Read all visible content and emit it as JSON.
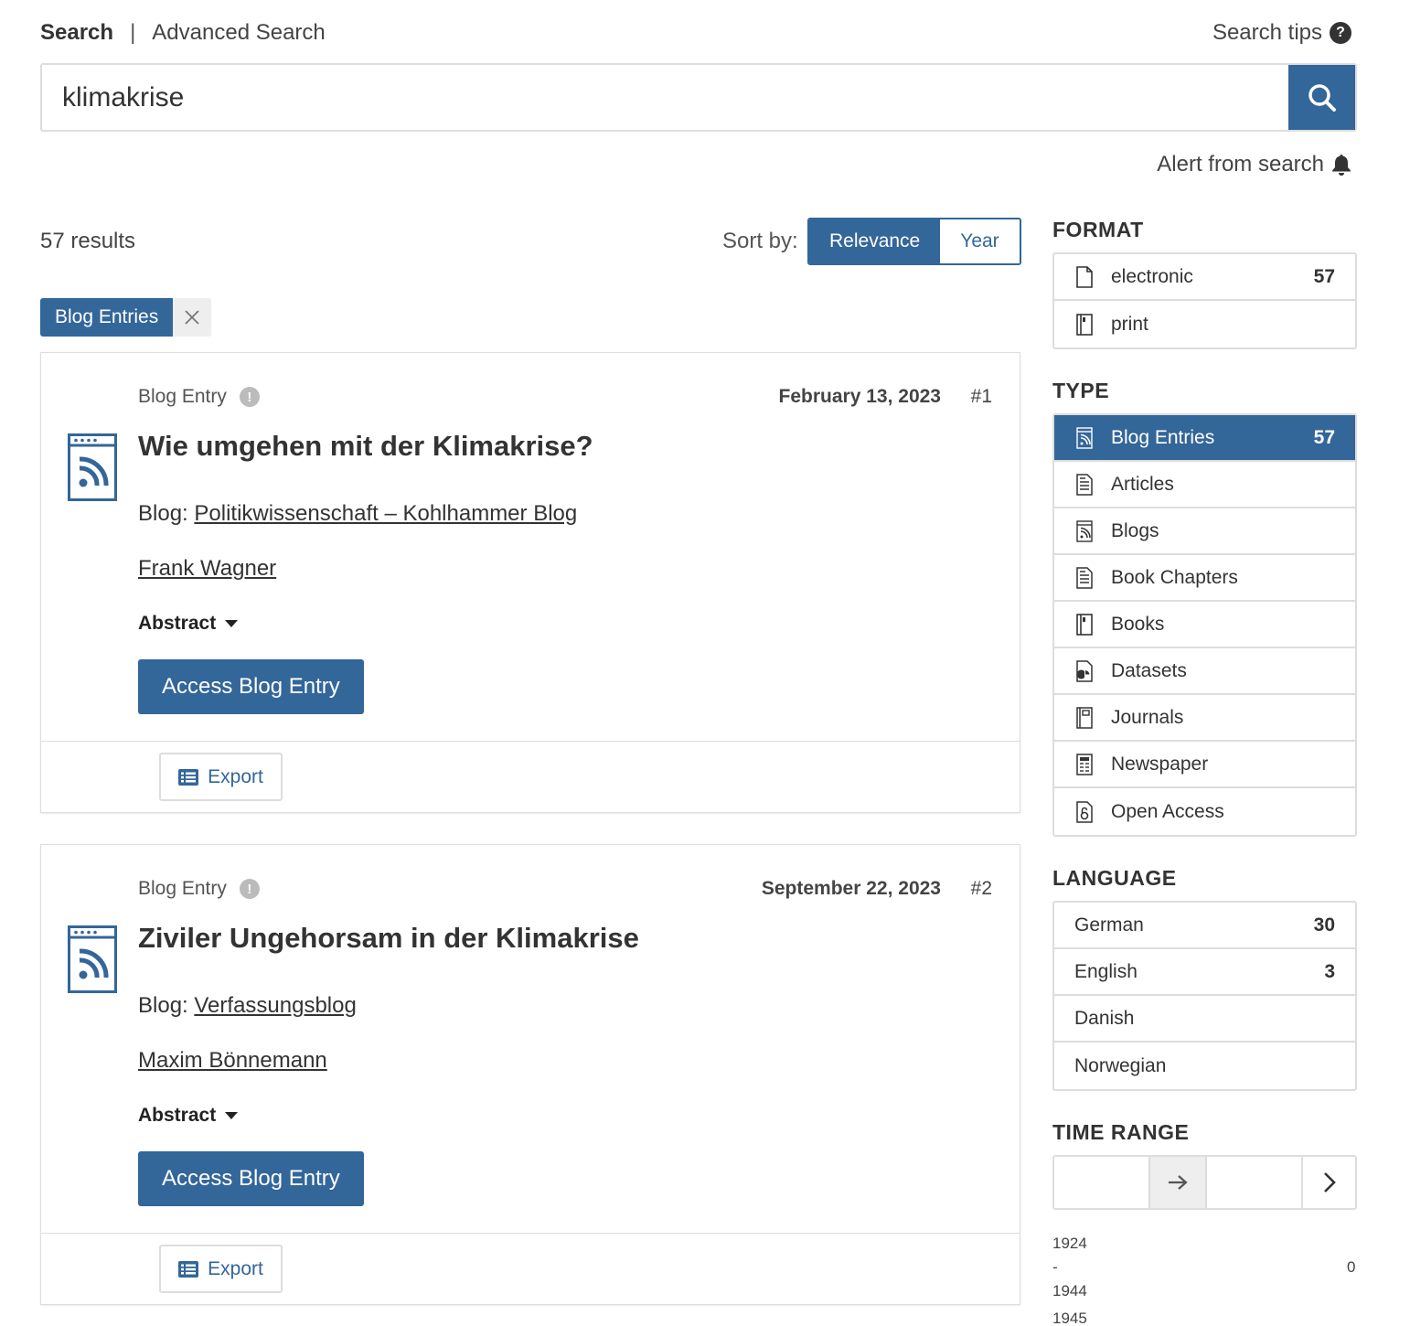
{
  "header": {
    "tab_search": "Search",
    "separator": "|",
    "tab_advanced": "Advanced Search",
    "search_tips": "Search tips",
    "search_tips_icon": "?",
    "query": "klimakrise",
    "alert_label": "Alert from search"
  },
  "results": {
    "count_label": "57 results",
    "sort_label": "Sort by:",
    "sort_options": [
      "Relevance",
      "Year"
    ],
    "active_filter": "Blog Entries",
    "accent_color": "#336699",
    "items": [
      {
        "type": "Blog Entry",
        "date": "February 13, 2023",
        "number": "#1",
        "title": "Wie umgehen mit der Klimakrise?",
        "blog_prefix": "Blog:",
        "blog_name": "Politikwissenschaft – Kohlhammer Blog",
        "author": "Frank Wagner",
        "abstract_label": "Abstract",
        "access_label": "Access Blog Entry",
        "export_label": "Export"
      },
      {
        "type": "Blog Entry",
        "date": "September 22, 2023",
        "number": "#2",
        "title": "Ziviler Ungehorsam in der Klimakrise",
        "blog_prefix": "Blog:",
        "blog_name": "Verfassungsblog",
        "author": "Maxim Bönnemann",
        "abstract_label": "Abstract",
        "access_label": "Access Blog Entry",
        "export_label": "Export"
      }
    ]
  },
  "sidebar": {
    "format": {
      "heading": "FORMAT",
      "items": [
        {
          "label": "electronic",
          "count": "57",
          "icon": "file-icon"
        },
        {
          "label": "print",
          "count": "",
          "icon": "book-icon"
        }
      ]
    },
    "type": {
      "heading": "TYPE",
      "items": [
        {
          "label": "Blog Entries",
          "count": "57",
          "icon": "rss-page-icon",
          "selected": true
        },
        {
          "label": "Articles",
          "count": "",
          "icon": "article-icon"
        },
        {
          "label": "Blogs",
          "count": "",
          "icon": "rss-page-icon"
        },
        {
          "label": "Book Chapters",
          "count": "",
          "icon": "article-icon"
        },
        {
          "label": "Books",
          "count": "",
          "icon": "book-icon"
        },
        {
          "label": "Datasets",
          "count": "",
          "icon": "dataset-icon"
        },
        {
          "label": "Journals",
          "count": "",
          "icon": "journal-icon"
        },
        {
          "label": "Newspaper",
          "count": "",
          "icon": "newspaper-icon"
        },
        {
          "label": "Open Access",
          "count": "",
          "icon": "open-access-icon"
        }
      ]
    },
    "language": {
      "heading": "LANGUAGE",
      "items": [
        {
          "label": "German",
          "count": "30"
        },
        {
          "label": "English",
          "count": "3"
        },
        {
          "label": "Danish",
          "count": ""
        },
        {
          "label": "Norwegian",
          "count": ""
        }
      ]
    },
    "time_range": {
      "heading": "TIME RANGE",
      "hist_start": "1924",
      "hist_dash": "-",
      "hist_end": "1944",
      "hist_value": "0",
      "hist_next": "1945"
    }
  }
}
